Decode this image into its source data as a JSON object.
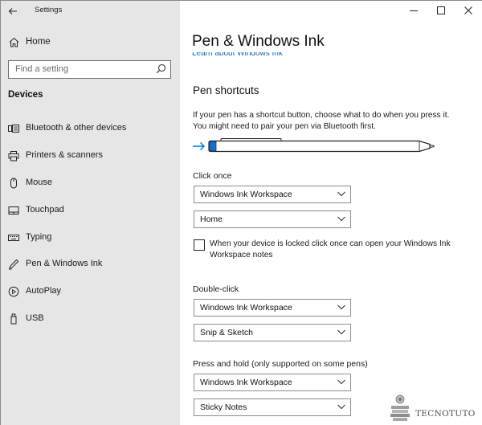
{
  "window": {
    "title": "Settings"
  },
  "sidebar": {
    "home_label": "Home",
    "search_placeholder": "Find a setting",
    "section_heading": "Devices",
    "items": [
      {
        "label": "Bluetooth & other devices",
        "icon": "bluetooth-devices-icon"
      },
      {
        "label": "Printers & scanners",
        "icon": "printer-icon"
      },
      {
        "label": "Mouse",
        "icon": "mouse-icon"
      },
      {
        "label": "Touchpad",
        "icon": "touchpad-icon"
      },
      {
        "label": "Typing",
        "icon": "keyboard-icon"
      },
      {
        "label": "Pen & Windows Ink",
        "icon": "pen-icon"
      },
      {
        "label": "AutoPlay",
        "icon": "autoplay-icon"
      },
      {
        "label": "USB",
        "icon": "usb-icon"
      }
    ]
  },
  "main": {
    "page_title": "Pen & Windows Ink",
    "learn_link": "Learn about Windows Ink",
    "pen_shortcuts": {
      "heading": "Pen shortcuts",
      "description": "If your pen has a shortcut button, choose what to do when you press it. You might need to pair your pen via Bluetooth first."
    },
    "click_once": {
      "label": "Click once",
      "app_select": "Windows Ink Workspace",
      "action_select": "Home",
      "lock_checkbox_label": "When your device is locked click once can open your Windows Ink Workspace notes",
      "lock_checkbox_checked": false
    },
    "double_click": {
      "label": "Double-click",
      "app_select": "Windows Ink Workspace",
      "action_select": "Snip & Sketch"
    },
    "press_hold": {
      "label": "Press and hold (only supported on some pens)",
      "app_select": "Windows Ink Workspace",
      "action_select": "Sticky Notes"
    }
  },
  "watermark": {
    "text": "TECNOTUTO"
  },
  "colors": {
    "sidebar_bg": "#e6e6e6",
    "accent": "#0078d7",
    "link": "#0a63b5"
  }
}
